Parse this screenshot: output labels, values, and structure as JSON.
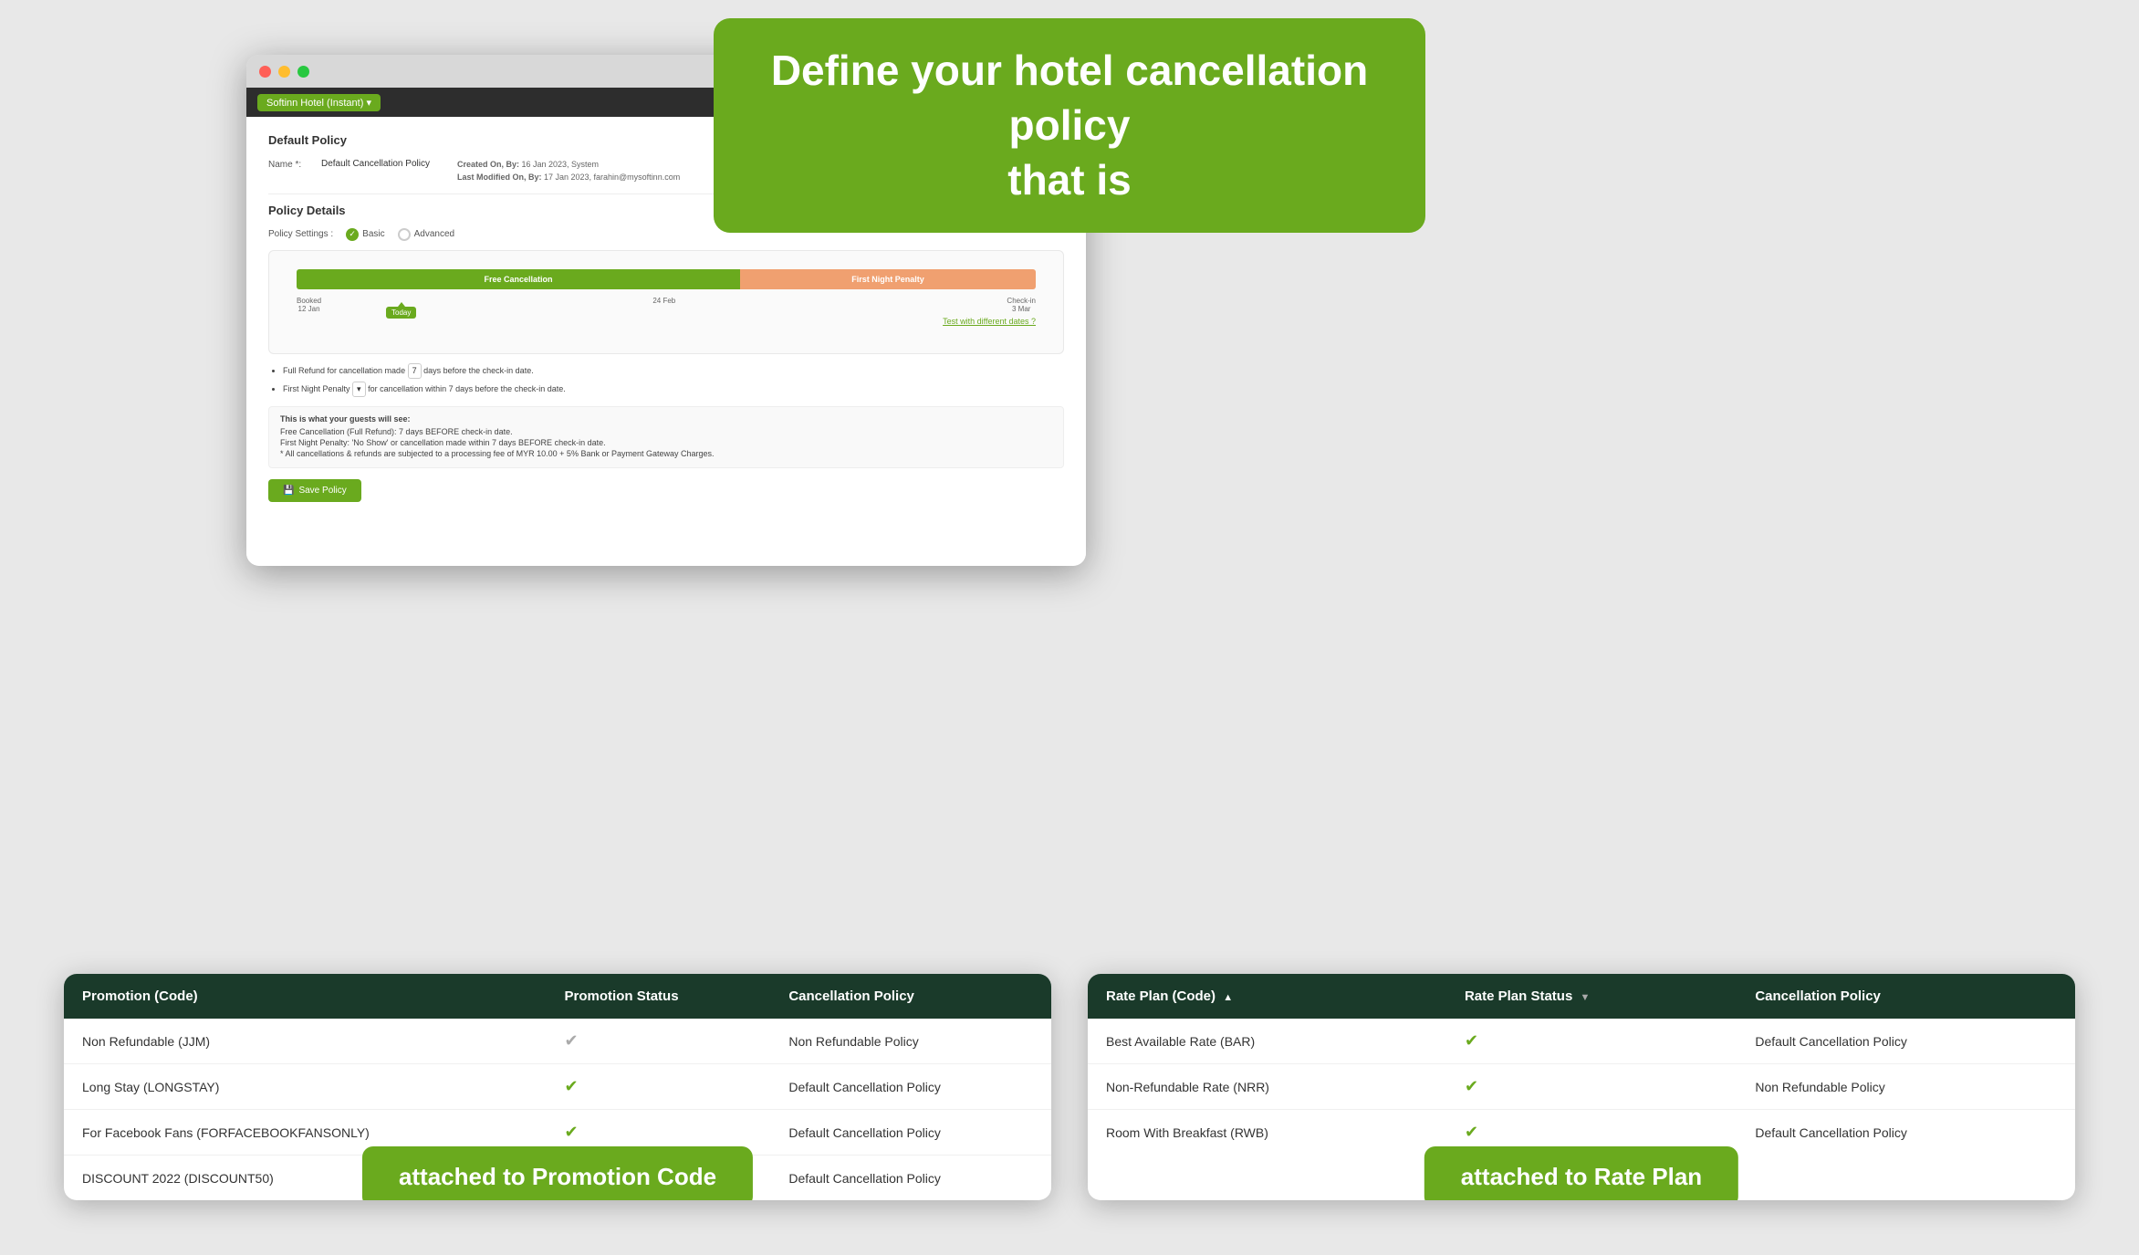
{
  "hero": {
    "line1": "Define your hotel cancellation policy",
    "line2": "that is"
  },
  "browser": {
    "brand": "Softinn Hotel (Instant) ▾",
    "user": "farahin@mysoftinn.com ▾",
    "page_title": "Default Policy",
    "name_label": "Name *:",
    "name_value": "Default Cancellation Policy",
    "created_label": "Created On, By:",
    "created_value": "16 Jan 2023, System",
    "modified_label": "Last Modified On, By:",
    "modified_value": "17 Jan 2023, farahin@mysoftinn.com",
    "policy_details_title": "Policy Details",
    "policy_settings_label": "Policy Settings :",
    "policy_basic": "Basic",
    "policy_advanced": "Advanced",
    "bar_green_label": "Free Cancellation",
    "bar_orange_label": "First Night Penalty",
    "date_booked": "Booked",
    "date_booked_val": "12 Jan",
    "date_mid": "24 Feb",
    "date_checkin": "Check-in",
    "date_checkin_val": "3 Mar",
    "today_label": "Today",
    "test_link": "Test with different dates ?",
    "rule1_prefix": "Full Refund for cancellation made",
    "rule1_days": "7",
    "rule1_suffix": "days before the check-in date.",
    "rule2_prefix": "First Night Penalty",
    "rule2_suffix": "for cancellation within 7 days before the check-in date.",
    "guest_view_title": "This is what your guests will see:",
    "guest_line1": "Free Cancellation (Full Refund): 7 days BEFORE check-in date.",
    "guest_line2": "First Night Penalty: 'No Show' or cancellation made within 7 days BEFORE check-in date.",
    "guest_line3": "* All cancellations & refunds are subjected to a processing fee of MYR 10.00 + 5% Bank or Payment Gateway Charges.",
    "save_button": "Save Policy"
  },
  "promo_table": {
    "col1": "Promotion (Code)",
    "col2": "Promotion Status",
    "col3": "Cancellation Policy",
    "rows": [
      {
        "name": "Non Refundable (JJM)",
        "status": "grey",
        "policy": "Non Refundable Policy"
      },
      {
        "name": "Long Stay (LONGSTAY)",
        "status": "green",
        "policy": "Default Cancellation Policy"
      },
      {
        "name": "For Facebook Fans (FORFACEBOOKFANSONLY)",
        "status": "green",
        "policy": "Default Cancellation Policy"
      },
      {
        "name": "DISCOUNT 2022 (DISCOUNT50)",
        "status": "green",
        "policy": "Default Cancellation Policy"
      }
    ]
  },
  "rate_table": {
    "col1": "Rate Plan (Code)",
    "col2": "Rate Plan Status",
    "col3": "Cancellation Policy",
    "rows": [
      {
        "name": "Best Available Rate (BAR)",
        "status": "green",
        "policy": "Default Cancellation Policy"
      },
      {
        "name": "Non-Refundable Rate (NRR)",
        "status": "green",
        "policy": "Non Refundable Policy"
      },
      {
        "name": "Room With Breakfast (RWB)",
        "status": "green",
        "policy": "Default Cancellation Policy"
      }
    ]
  },
  "tooltip_promo": "attached to Promotion Code",
  "tooltip_rate": "attached to Rate Plan"
}
